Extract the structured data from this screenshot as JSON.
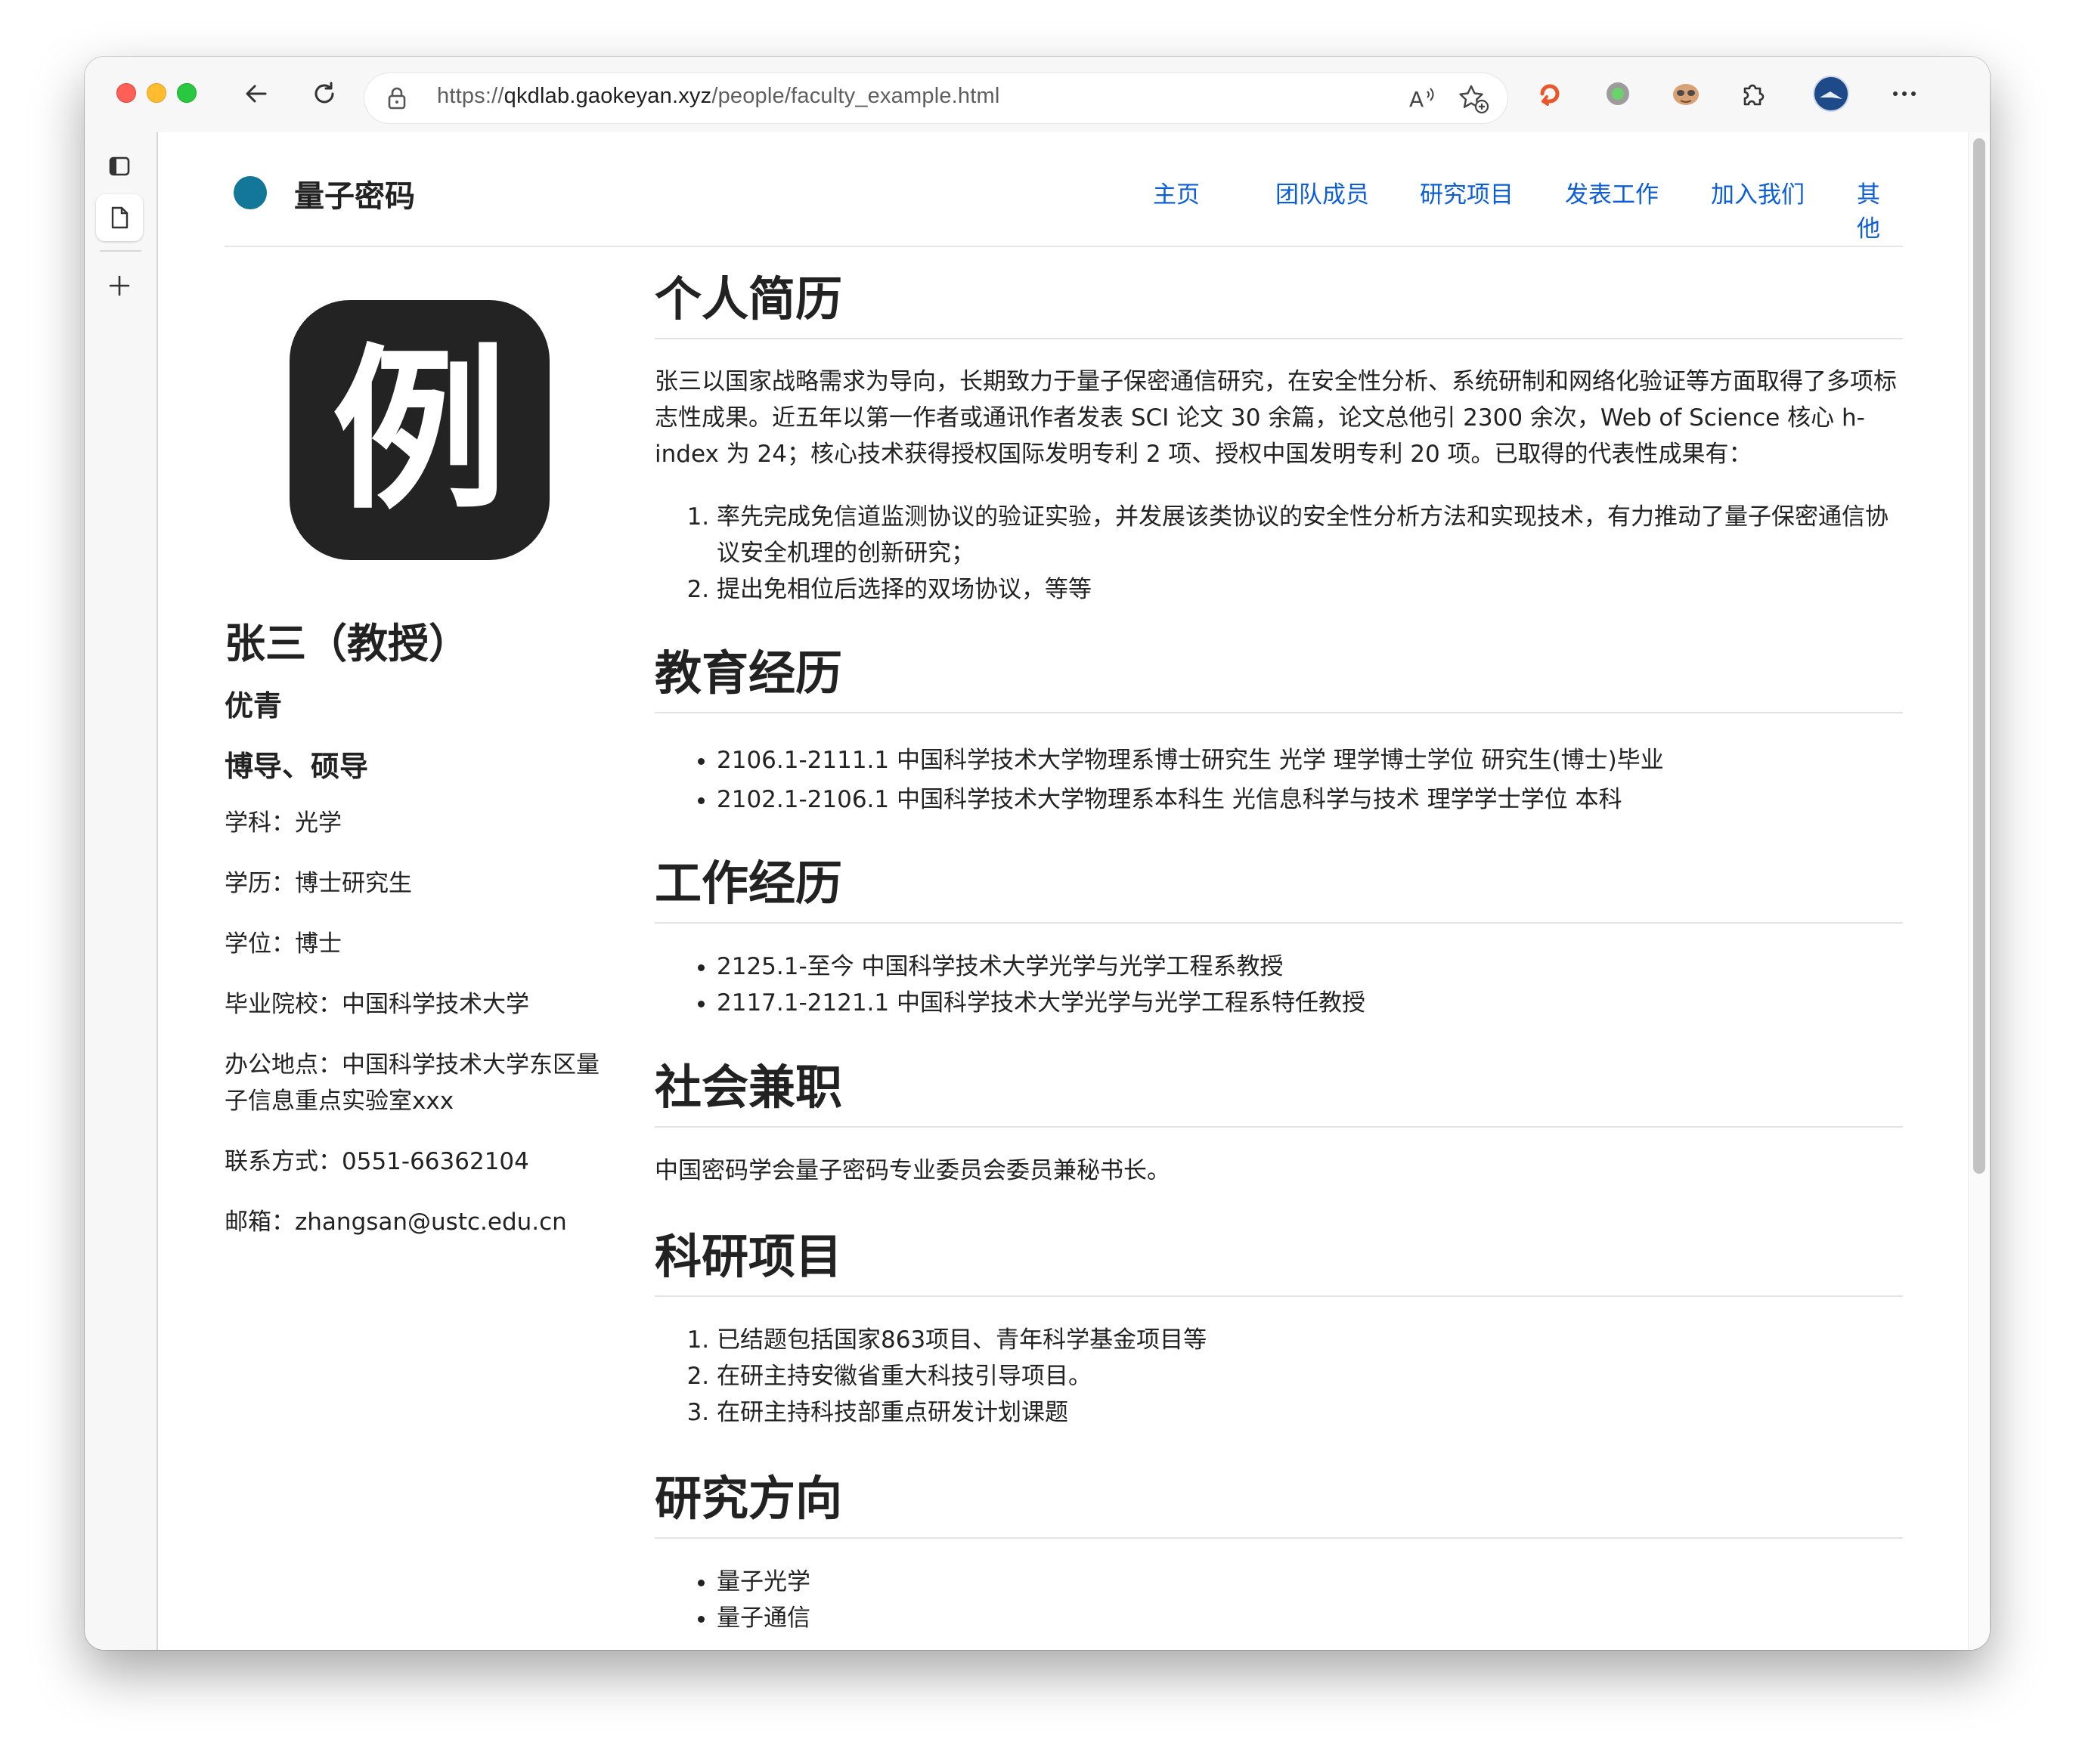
{
  "browser": {
    "url_prefix": "https://",
    "url_host": "qkdlab.gaokeyan.xyz",
    "url_path": "/people/faculty_example.html"
  },
  "site": {
    "brand": "量子密码",
    "brand_color": "#127799",
    "nav": [
      "主页",
      "团队成员",
      "研究项目",
      "发表工作",
      "加入我们",
      "其他"
    ]
  },
  "profile": {
    "logo_char": "例",
    "name": "张三（教授）",
    "honor": "优青",
    "supervisor": "博导、硕导",
    "discipline": "学科：光学",
    "education": "学历：博士研究生",
    "degree": "学位：博士",
    "school": "毕业院校：中国科学技术大学",
    "office": "办公地点：中国科学技术大学东区量子信息重点实验室xxx",
    "phone": "联系方式：0551-66362104",
    "email": "邮箱：zhangsan@ustc.edu.cn"
  },
  "sections": {
    "bio": {
      "title": "个人简历",
      "text": "张三以国家战略需求为导向，长期致力于量子保密通信研究，在安全性分析、系统研制和网络化验证等方面取得了多项标志性成果。近五年以第一作者或通讯作者发表 SCI 论文 30 余篇，论文总他引 2300 余次，Web of Science 核心 h-index 为 24；核心技术获得授权国际发明专利 2 项、授权中国发明专利 20 项。已取得的代表性成果有：",
      "items": [
        "率先完成免信道监测协议的验证实验，并发展该类协议的安全性分析方法和实现技术，有力推动了量子保密通信协议安全机理的创新研究；",
        "提出免相位后选择的双场协议，等等"
      ]
    },
    "education": {
      "title": "教育经历",
      "items": [
        "2106.1-2111.1 中国科学技术大学物理系博士研究生 光学 理学博士学位 研究生(博士)毕业",
        "2102.1-2106.1 中国科学技术大学物理系本科生 光信息科学与技术 理学学士学位 本科"
      ]
    },
    "work": {
      "title": "工作经历",
      "items": [
        "2125.1-至今 中国科学技术大学光学与光学工程系教授",
        "2117.1-2121.1 中国科学技术大学光学与光学工程系特任教授"
      ]
    },
    "social": {
      "title": "社会兼职",
      "text": "中国密码学会量子密码专业委员会委员兼秘书长。"
    },
    "projects": {
      "title": "科研项目",
      "items": [
        "已结题包括国家863项目、青年科学基金项目等",
        "在研主持安徽省重大科技引导项目。",
        "在研主持科技部重点研发计划课题"
      ]
    },
    "research": {
      "title": "研究方向",
      "items": [
        "量子光学",
        "量子通信"
      ]
    }
  }
}
